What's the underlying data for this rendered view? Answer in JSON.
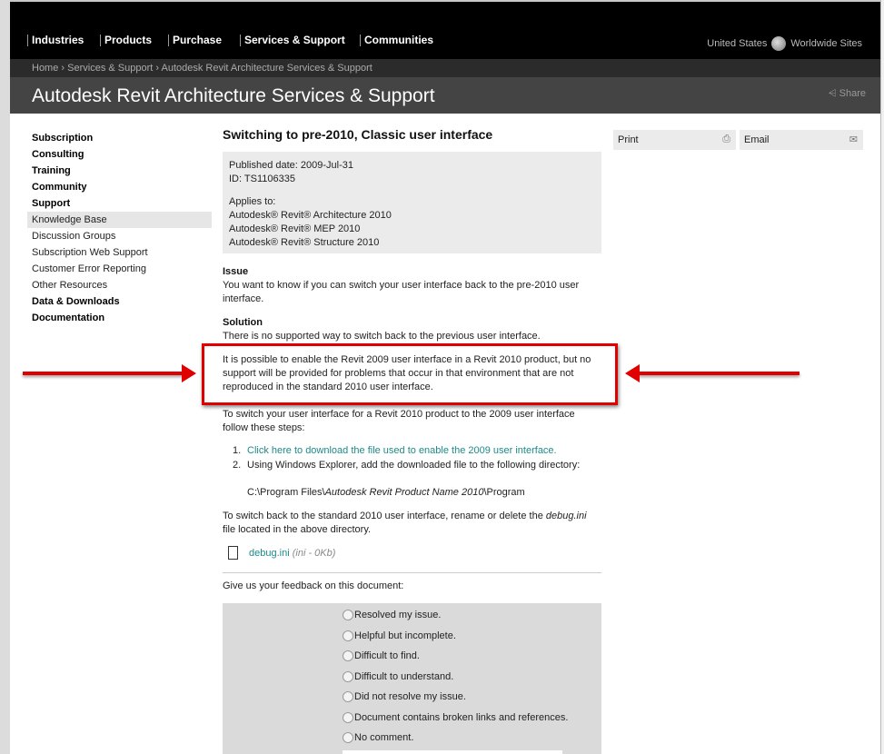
{
  "nav": {
    "items": [
      "Industries",
      "Products",
      "Purchase",
      "Services & Support",
      "Communities"
    ],
    "region": "United States",
    "worldwide": "Worldwide Sites"
  },
  "breadcrumb": [
    "Home",
    "Services & Support",
    "Autodesk Revit Architecture Services & Support"
  ],
  "breadcrumb_sep": "›",
  "page_title": "Autodesk Revit Architecture Services & Support",
  "share": "Share",
  "sidebar": [
    "Subscription",
    "Consulting",
    "Training",
    "Community",
    "Support",
    "Knowledge Base",
    "Discussion Groups",
    "Subscription Web Support",
    "Customer Error Reporting",
    "Other Resources",
    "Data & Downloads",
    "Documentation"
  ],
  "article": {
    "title": "Switching to pre-2010, Classic user interface",
    "published": "Published date: 2009-Jul-31",
    "id": "ID: TS1106335",
    "applies_label": "Applies to:",
    "applies": [
      "Autodesk® Revit® Architecture 2010",
      "Autodesk® Revit® MEP 2010",
      "Autodesk® Revit® Structure 2010"
    ],
    "issue_h": "Issue",
    "issue": "You want to know if you can switch your user interface back to the pre-2010 user interface.",
    "solution_h": "Solution",
    "solution": "There is no supported way to switch back to the previous user interface.",
    "highlight": "It is possible to enable the Revit 2009 user interface in a Revit 2010 product, but no support will be provided for problems that occur in that environment that are not reproduced in the standard 2010 user interface.",
    "steps_intro": "To switch your user interface for a Revit 2010 product to the 2009 user interface follow these steps:",
    "step1": "Click here to download the file used to enable the 2009 user interface.",
    "step2": "Using Windows Explorer, add the downloaded file to the following directory:",
    "path_a": "C:\\Program Files\\",
    "path_b": "Autodesk Revit Product Name 2010",
    "path_c": "\\Program",
    "switch_back_a": "To switch back to the standard 2010 user interface, rename or delete the ",
    "switch_back_b": "debug.ini",
    "switch_back_c": " file located in the above directory.",
    "file": "debug.ini",
    "file_meta": "(ini - 0Kb)",
    "feedback": "Give us your feedback on this document:",
    "options": [
      "Resolved my issue.",
      "Helpful but incomplete.",
      "Difficult to find.",
      "Difficult to understand.",
      "Did not resolve my issue.",
      "Document contains broken links and references.",
      "No comment."
    ]
  },
  "tools": {
    "print": "Print",
    "email": "Email"
  },
  "colors": {
    "highlight": "#e00000",
    "link": "#1d8a8a"
  }
}
